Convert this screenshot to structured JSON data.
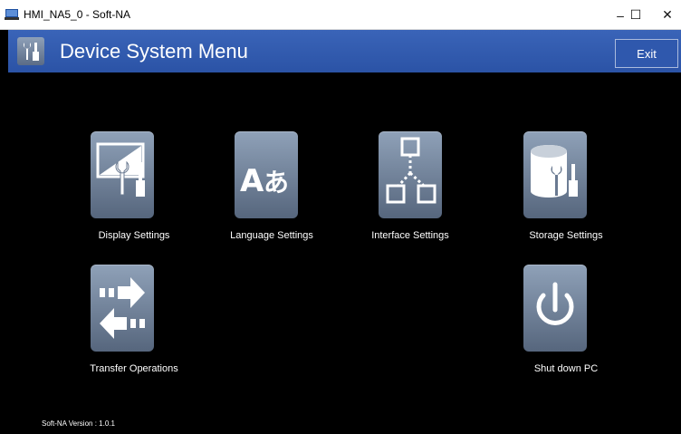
{
  "window": {
    "title": "HMI_NA5_0 - Soft-NA",
    "minimize_glyph": "–",
    "maximize_glyph": "☐",
    "close_glyph": "✕"
  },
  "header": {
    "title": "Device System Menu",
    "exit_label": "Exit",
    "icon": "tools-icon"
  },
  "menu": {
    "items": [
      {
        "label": "Display Settings",
        "icon": "display-settings-icon"
      },
      {
        "label": "Language Settings",
        "icon": "language-settings-icon"
      },
      {
        "label": "Interface Settings",
        "icon": "interface-settings-icon"
      },
      {
        "label": "Storage Settings",
        "icon": "storage-settings-icon"
      },
      {
        "label": "Transfer Operations",
        "icon": "transfer-operations-icon"
      },
      {
        "label": "Shut down PC",
        "icon": "power-icon"
      }
    ]
  },
  "footer": {
    "version": "Soft-NA Version : 1.0.1"
  },
  "colors": {
    "header_blue": "#2b53a6",
    "tile_gray": "#6e7f96",
    "background": "#000000"
  }
}
